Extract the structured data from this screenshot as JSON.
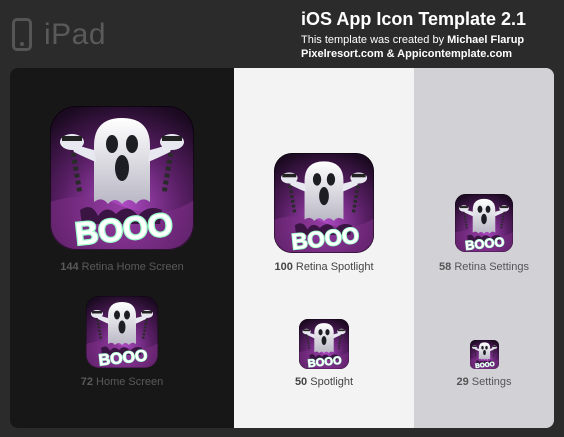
{
  "header": {
    "device_label": "iPad",
    "title": "iOS App Icon Template 2.1",
    "credit_prefix": "This template was created by ",
    "credit_author": "Michael Flarup",
    "sites": "Pixelresort.com & Appicontemplate.com"
  },
  "icon": {
    "name": "ghost-booo-icon",
    "lettering": "BOOO",
    "colors": {
      "background": "#5a1f66",
      "background_glow": "#b04bc6",
      "ghost": "#e8e8f0",
      "text_glow": "#9dffc9"
    }
  },
  "columns": {
    "dark": {
      "top": {
        "size": "144",
        "label": " Retina Home Screen"
      },
      "bottom": {
        "size": "72",
        "label": " Home Screen"
      }
    },
    "light": {
      "top": {
        "size": "100",
        "label": " Retina Spotlight"
      },
      "bottom": {
        "size": "50",
        "label": " Spotlight"
      }
    },
    "grey": {
      "top": {
        "size": "58",
        "label": " Retina Settings"
      },
      "bottom": {
        "size": "29",
        "label": " Settings"
      }
    }
  }
}
